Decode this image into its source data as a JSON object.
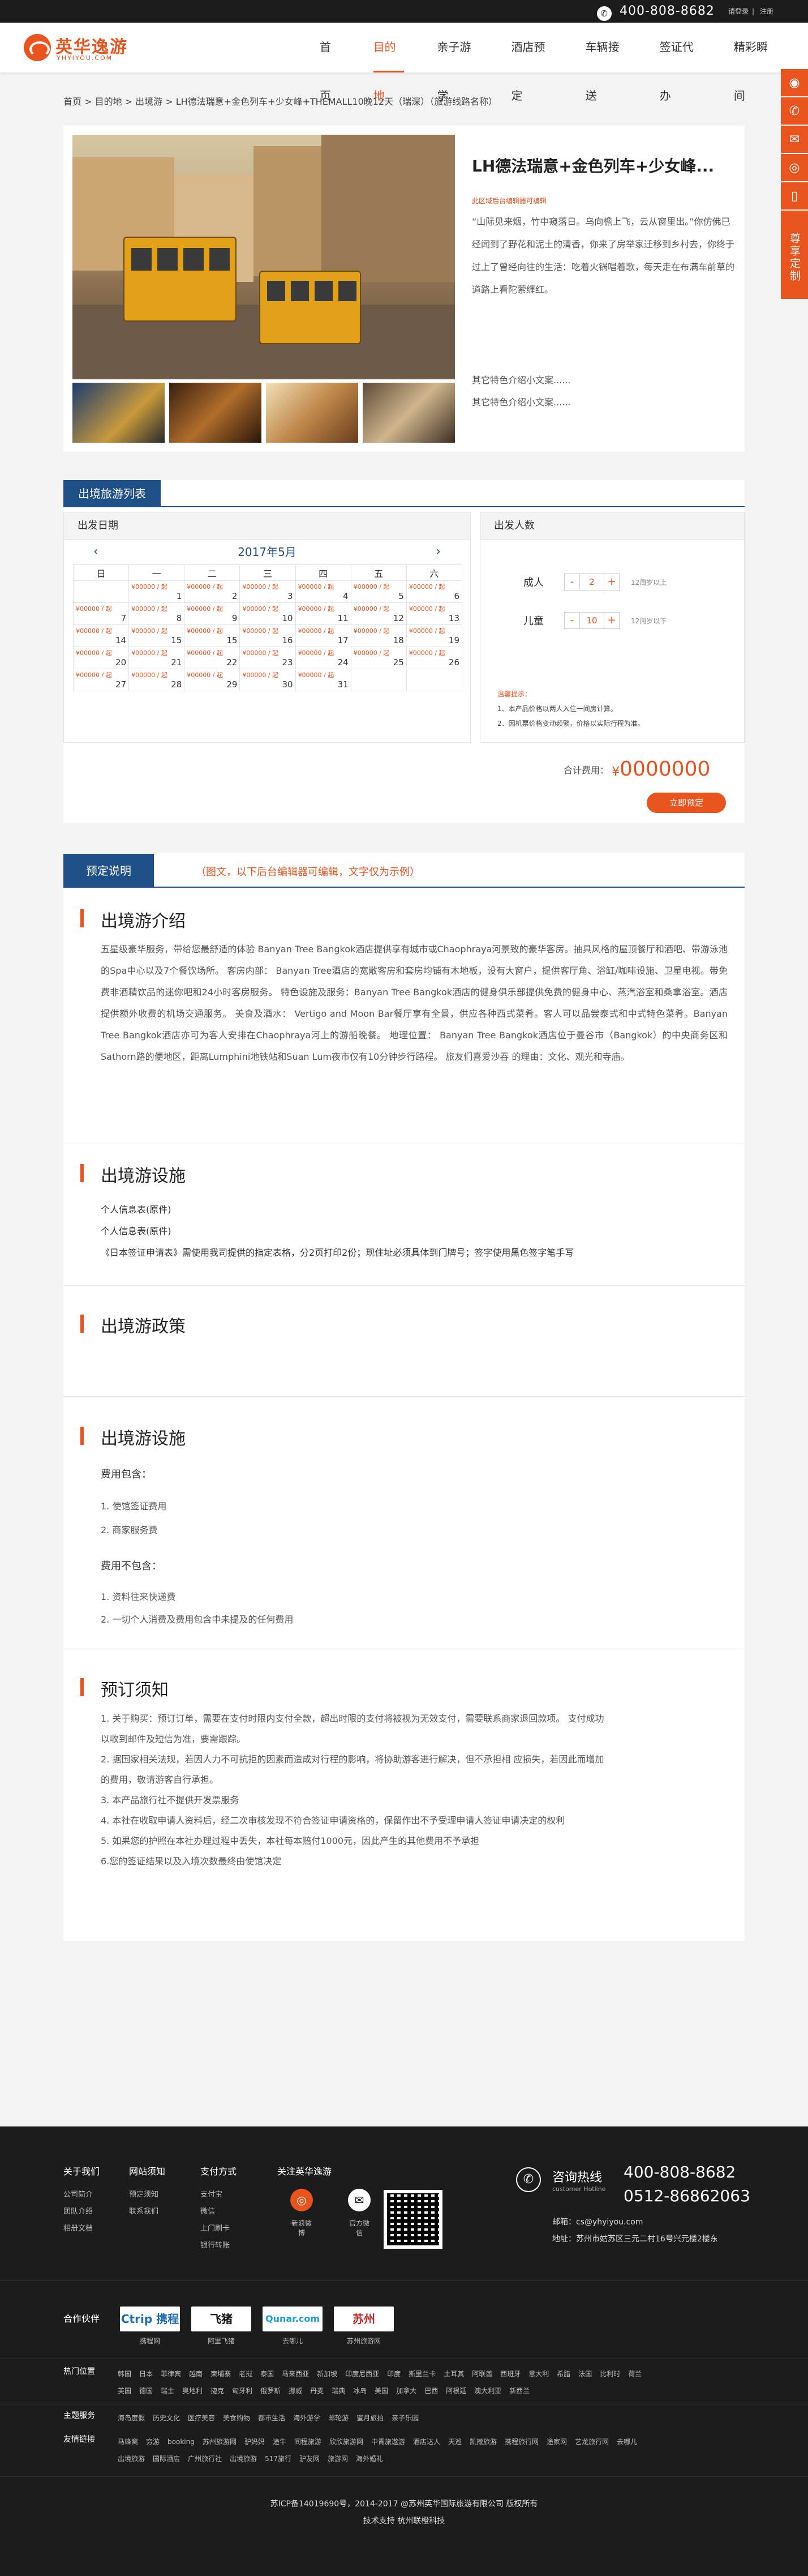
{
  "topbar": {
    "phone": "400-808-8682",
    "login": "请登录",
    "register": "注册"
  },
  "logo": {
    "name": "英华逸游",
    "domain": "YHYIYOU.COM"
  },
  "nav": [
    "首页",
    "目的地",
    "亲子游学",
    "酒店预定",
    "车辆接送",
    "签证代办",
    "精彩瞬间"
  ],
  "sidebar": {
    "custom": "尊享定制"
  },
  "breadcrumb": "首页 > 目的地 > 出境游 > LH德法瑞意+金色列车+少女峰+THEMALL10晚12天（瑞深）（旅游线路名称）",
  "product": {
    "title": "LH德法瑞意+金色列车+少女峰...",
    "edit_note": "此区域后台编辑器可编辑",
    "poem": "“山际见来烟，竹中窥落日。乌向檐上飞，云从窗里出。”你仿佛已经闻到了野花和泥土的清香，你来了房举家迁移到乡村去，你终于过上了曾经向往的生活：吃着火锅唱着歌，每天走在布满车前草的道路上看陀萦缠红。",
    "features": [
      "其它特色介绍小文案......",
      "其它特色介绍小文案......"
    ]
  },
  "booking": {
    "tab": "出境旅游列表",
    "date_label": "出发日期",
    "month": "2017年5月",
    "weekdays": [
      "日",
      "一",
      "二",
      "三",
      "四",
      "五",
      "六"
    ],
    "price": "¥00000 / 起",
    "weeks": [
      [
        "",
        "1",
        "2",
        "3",
        "4",
        "5",
        "6"
      ],
      [
        "7",
        "8",
        "9",
        "10",
        "11",
        "12",
        "13"
      ],
      [
        "14",
        "15",
        "15",
        "16",
        "17",
        "18",
        "19"
      ],
      [
        "20",
        "21",
        "22",
        "23",
        "24",
        "25",
        "26"
      ],
      [
        "27",
        "28",
        "29",
        "30",
        "31",
        "",
        ""
      ]
    ],
    "people_label": "出发人数",
    "adult": {
      "label": "成人",
      "value": "2",
      "hint": "12周岁以上"
    },
    "child": {
      "label": "儿童",
      "value": "10",
      "hint": "12周岁以下"
    },
    "note_title": "温馨提示：",
    "notes": [
      "1、本产品价格以两人入住一间房计算。",
      "2、因机票价格变动频繁，价格以实际行程为准。"
    ],
    "total_label": "合计费用：",
    "total_value": "0000000",
    "currency": "¥",
    "book_button": "立即预定"
  },
  "details": {
    "tab": "预定说明",
    "tab_note": "（图文，以下后台编辑器可编辑，文字仅为示例）",
    "intro_title": "出境游介绍",
    "intro_body": "五星级豪华服务，带给您最舒适的体验 Banyan Tree Bangkok酒店提供享有城市或Chaophraya河景致的豪华客房。抽具风格的屋顶餐厅和酒吧、带游泳池的Spa中心以及7个餐饮场所。 客房内部： Banyan Tree酒店的宽敞客房和套房均铺有木地板，设有大窗户，提供客厅角、浴缸/咖啡设施、卫星电视。带免费非酒精饮品的迷你吧和24小时客房服务。 特色设施及服务：Banyan Tree Bangkok酒店的健身俱乐部提供免费的健身中心、蒸汽浴室和桑拿浴室。酒店提供额外收费的机场交通服务。 美食及酒水： Vertigo and Moon Bar餐厅享有全景，供应各种西式菜肴。客人可以品尝泰式和中式特色菜肴。Banyan Tree Bangkok酒店亦可为客人安排在Chaophraya河上的游船晚餐。 地理位置： Banyan Tree Bangkok酒店位于曼谷市（Bangkok）的中央商务区和Sathorn路的便地区，距离Lumphini地铁站和Suan Lum夜市仅有10分钟步行路程。 旅友们喜爱沙吞 的理由：文化、观光和寺庙。",
    "facility_title": "出境游设施",
    "facility_lines": [
      "个人信息表(原件)",
      "个人信息表(原件)",
      "《日本签证申请表》需使用我司提供的指定表格，分2页打印2份；现住址必须具体到门牌号；签字使用黑色签字笔手写"
    ],
    "policy_title": "出境游政策",
    "fee_title": "出境游设施",
    "fee_include_label": "费用包含：",
    "fee_include": [
      "1. 使馆签证费用",
      "2. 商家服务费"
    ],
    "fee_exclude_label": "费用不包含：",
    "fee_exclude": [
      "1. 资料往来快递费",
      "2. 一切个人消费及费用包含中未提及的任何费用"
    ],
    "notice_title": "预订须知",
    "notice": [
      "1. 关于购买：预订订单，需要在支付时限内支付全款，超出时限的支付将被视为无效支付，需要联系商家退回款项。 支付成功",
      "以收到邮件及短信为准，要需跟踪。",
      "2. 据国家相关法规，若因人力不可抗拒的因素而造成对行程的影响，将协助游客进行解决，但不承担相 应损失，若因此而增加",
      "的费用，敬请游客自行承担。",
      "3. 本产品旅行社不提供开发票服务",
      "4. 本社在收取申请人资料后，经二次审核发现不符合签证申请资格的，保留作出不予受理申请人签证申请决定的权利",
      "5. 如果您的护照在本社办理过程中丢失，本社每本赔付1000元，因此产生的其他费用不予承担",
      "6.您的签证结果以及入境次数最终由使馆决定"
    ]
  },
  "footer": {
    "cols": [
      {
        "title": "关于我们",
        "items": [
          "公司简介",
          "团队介绍",
          "相册文档"
        ]
      },
      {
        "title": "网站须知",
        "items": [
          "预定须知",
          "联系我们"
        ]
      },
      {
        "title": "支付方式",
        "items": [
          "支付宝",
          "微信",
          "上门刷卡",
          "银行转账"
        ]
      }
    ],
    "follow_title": "关注英华逸游",
    "weibo": "新浪微博",
    "wechat": "官方微信",
    "hotline_title": "咨询热线",
    "hotline_sub": "customer Hotline",
    "phone1": "400-808-8682",
    "phone2": "0512-86862063",
    "email": "邮箱：cs@yhyiyou.com",
    "address": "地址：苏州市姑苏区三元二村16号兴元楼2楼东",
    "partner_label": "合作伙伴",
    "partners": [
      {
        "logo": "Ctrip 携程",
        "name": "携程网"
      },
      {
        "logo": "飞猪",
        "name": "阿里飞猪"
      },
      {
        "logo": "Qunar.com",
        "name": "去哪儿"
      },
      {
        "logo": "苏州",
        "name": "苏州旅游网"
      }
    ],
    "hot_label": "热门位置",
    "hot_items_1": [
      "韩国",
      "日本",
      "菲律宾",
      "越南",
      "柬埔寨",
      "老挝",
      "泰国",
      "马来西亚",
      "新加坡",
      "印度尼西亚",
      "印度",
      "斯里兰卡",
      "土耳其",
      "阿联酋",
      "西班牙",
      "意大利",
      "希腊",
      "法国",
      "比利时",
      "荷兰"
    ],
    "hot_items_2": [
      "英国",
      "德国",
      "瑞士",
      "奥地利",
      "捷克",
      "匈牙利",
      "俄罗斯",
      "挪威",
      "丹麦",
      "瑞典",
      "冰岛",
      "美国",
      "加拿大",
      "巴西",
      "阿根廷",
      "澳大利亚",
      "新西兰"
    ],
    "theme_label": "主题服务",
    "theme_items": [
      "海岛度假",
      "历史文化",
      "医疗美容",
      "美食购物",
      "都市生活",
      "海外游学",
      "邮轮游",
      "蜜月旅拍",
      "亲子乐园"
    ],
    "links_label": "友情链接",
    "links_1": [
      "马蜂窝",
      "穷游",
      "booking",
      "苏州旅游网",
      "驴妈妈",
      "途牛",
      "同程旅游",
      "欣欣旅游网",
      "中青旅遨游",
      "酒店达人",
      "天巡",
      "凯撒旅游",
      "携程旅行网",
      "途家网",
      "艺龙旅行网",
      "去哪儿"
    ],
    "links_2": [
      "出境旅游",
      "国际酒店",
      "广州旅行社",
      "出境旅游",
      "517旅行",
      "驴友网",
      "旅游网",
      "海外婚礼"
    ],
    "icp": "苏ICP备14019690号，2014-2017 @苏州英华国际旅游有限公司 版权所有",
    "support": "技术支持 杭州联橙科技"
  }
}
